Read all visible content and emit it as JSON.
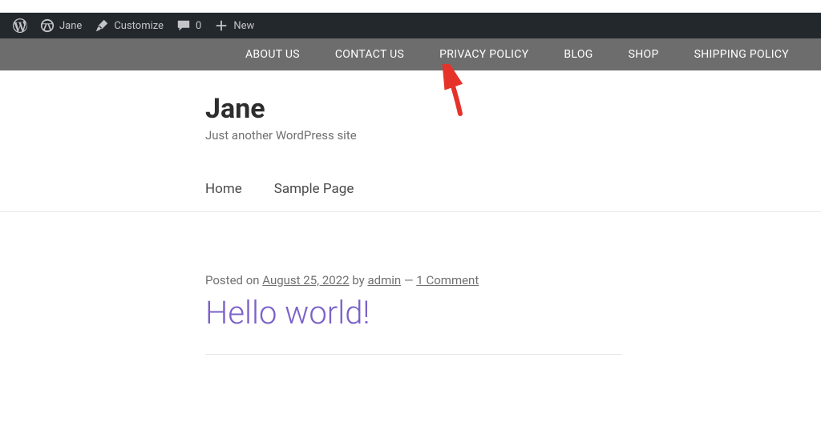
{
  "adminbar": {
    "site_name": "Jane",
    "customize": "Customize",
    "comment_count": "0",
    "new": "New"
  },
  "nav": {
    "items": [
      "ABOUT US",
      "CONTACT US",
      "PRIVACY POLICY",
      "BLOG",
      "SHOP",
      "SHIPPING POLICY"
    ]
  },
  "header": {
    "title": "Jane",
    "tagline": "Just another WordPress site"
  },
  "page_nav": {
    "items": [
      "Home",
      "Sample Page"
    ]
  },
  "post": {
    "meta_prefix": "Posted on ",
    "date": "August 25, 2022",
    "by_label": " by ",
    "author": "admin",
    "sep": " — ",
    "comments": "1 Comment",
    "title": "Hello world!"
  }
}
